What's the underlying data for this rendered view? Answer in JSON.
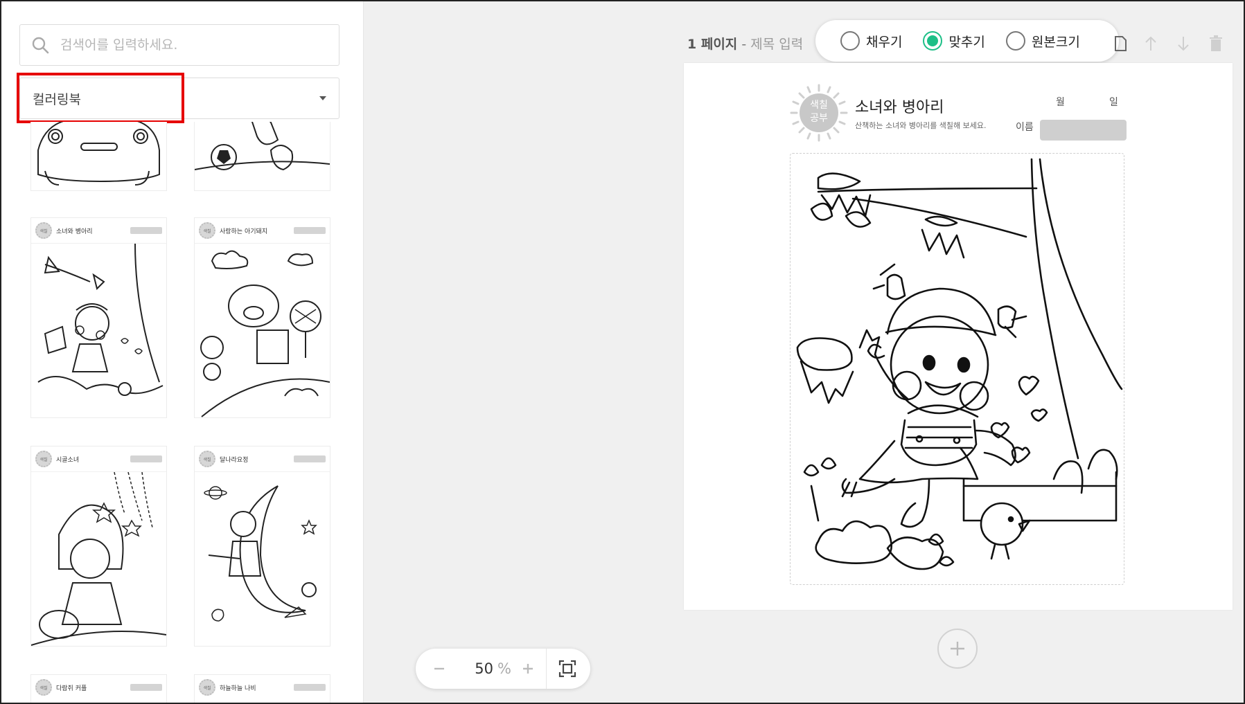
{
  "sidebar": {
    "search": {
      "placeholder": "검색어를 입력하세요.",
      "value": ""
    },
    "category": {
      "selected": "컬러링북"
    },
    "thumbnails": [
      {
        "title": ""
      },
      {
        "title": ""
      },
      {
        "title": "소녀와 병아리"
      },
      {
        "title": "사랑하는 아기돼지"
      },
      {
        "title": "시골소녀"
      },
      {
        "title": "달나라요정"
      },
      {
        "title": "다람쥐 커플"
      },
      {
        "title": "하늘하늘 나비"
      }
    ]
  },
  "page_header": {
    "page_num": "1 페이지",
    "separator": " - ",
    "title_placeholder": "제목 입력"
  },
  "fit_options": {
    "options": [
      {
        "label": "채우기",
        "selected": false
      },
      {
        "label": "맞추기",
        "selected": true
      },
      {
        "label": "원본크기",
        "selected": false
      }
    ]
  },
  "sheet": {
    "badge_line1": "색칠",
    "badge_line2": "공부",
    "title": "소녀와 병아리",
    "subtitle": "산책하는 소녀와 병아리를 색칠해 보세요.",
    "month_label": "월",
    "day_label": "일",
    "name_label": "이름"
  },
  "zoom": {
    "value": "50",
    "unit": "%"
  },
  "icons": {
    "search": "search-icon",
    "dropdown": "chevron-down-icon",
    "copy": "copy-page-icon",
    "up": "arrow-up-icon",
    "down": "arrow-down-icon",
    "delete": "trash-icon",
    "add": "plus-icon",
    "fit": "fit-screen-icon"
  },
  "colors": {
    "accent": "#1dbf87",
    "highlight": "#e60000",
    "workspace_bg": "#f0f0f0"
  }
}
